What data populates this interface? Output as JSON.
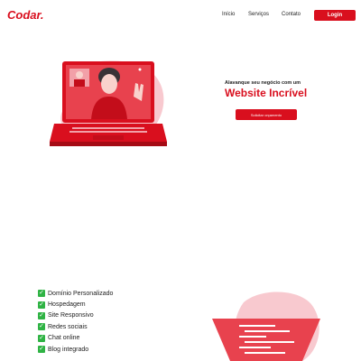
{
  "header": {
    "logo": "Codar.",
    "nav": [
      "Início",
      "Serviços",
      "Contato"
    ],
    "login_label": "Login"
  },
  "hero": {
    "tagline": "Alavanque seu negócio com um",
    "headline": "Website Incrível",
    "cta_label": "Solicitar orçamento"
  },
  "features": [
    "Domínio Personalizado",
    "Hospedagem",
    "Site Responsivo",
    "Redes sociais",
    "Chat online",
    "Blog integrado"
  ],
  "colors": {
    "brand": "#d90f1e",
    "check": "#2fb344",
    "blob": "#f8c9cf"
  }
}
